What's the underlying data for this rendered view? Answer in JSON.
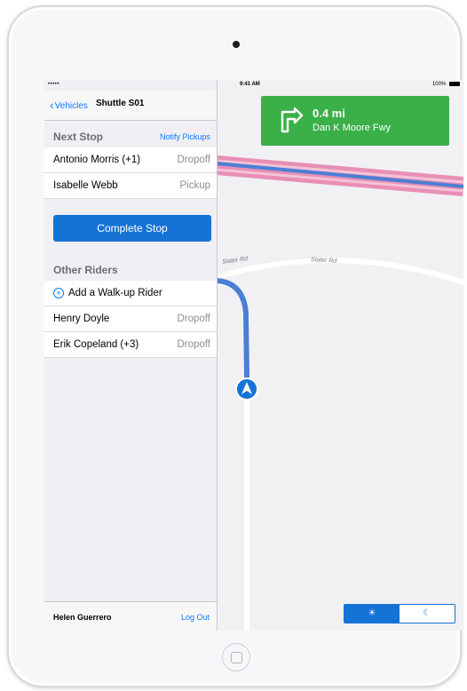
{
  "status_bar": {
    "carrier": "•••••",
    "wifi": "wifi-icon",
    "time": "9:41 AM",
    "battery": "100%"
  },
  "nav": {
    "back_label": "Vehicles",
    "title": "Shuttle S01"
  },
  "next_stop": {
    "header": "Next Stop",
    "action": "Notify Pickups",
    "riders": [
      {
        "name": "Antonio Morris (+1)",
        "role": "Dropoff"
      },
      {
        "name": "Isabelle Webb",
        "role": "Pickup"
      }
    ],
    "complete_button": "Complete Stop"
  },
  "other_riders": {
    "header": "Other Riders",
    "add_label": "Add a Walk-up Rider",
    "riders": [
      {
        "name": "Henry Doyle",
        "role": "Dropoff"
      },
      {
        "name": "Erik Copeland (+3)",
        "role": "Dropoff"
      }
    ]
  },
  "footer": {
    "user": "Helen Guerrero",
    "logout": "Log Out"
  },
  "navigation_banner": {
    "distance": "0.4 mi",
    "street": "Dan K Moore Fwy",
    "icon": "turn-right-icon"
  },
  "map": {
    "road_labels": [
      "Slater Rd",
      "Slater Rd"
    ]
  },
  "mode_toggle": {
    "day_icon": "☀",
    "night_icon": "☾",
    "selected": "day"
  },
  "colors": {
    "accent": "#0a7aff",
    "button": "#1673d6",
    "banner": "#3bb049",
    "highway": "#e88fb5",
    "route": "#4a7fd4"
  }
}
